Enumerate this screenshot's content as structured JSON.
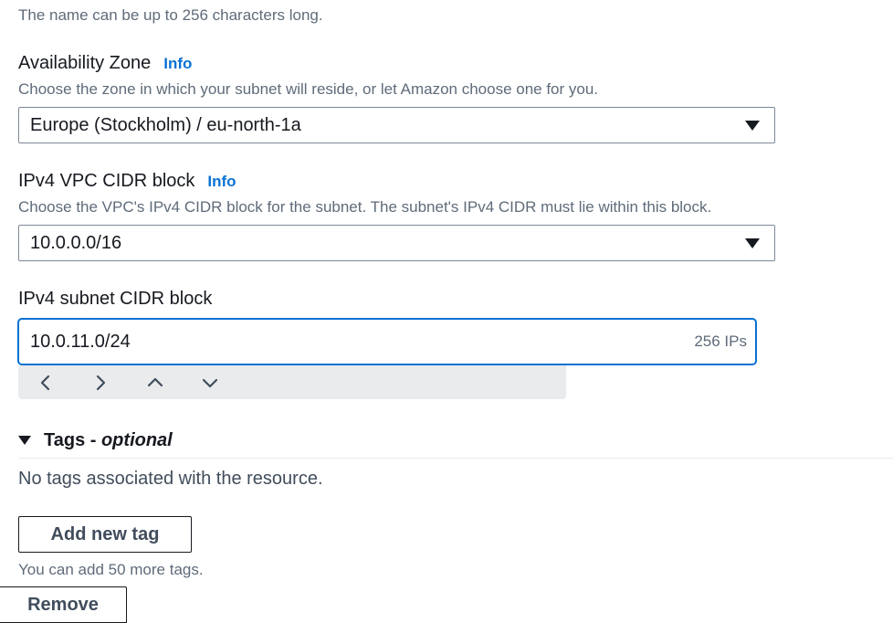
{
  "name_hint": "The name can be up to 256 characters long.",
  "availability_zone": {
    "label": "Availability Zone",
    "info": "Info",
    "description": "Choose the zone in which your subnet will reside, or let Amazon choose one for you.",
    "selected": "Europe (Stockholm) / eu-north-1a"
  },
  "vpc_cidr": {
    "label": "IPv4 VPC CIDR block",
    "info": "Info",
    "description": "Choose the VPC's IPv4 CIDR block for the subnet. The subnet's IPv4 CIDR must lie within this block.",
    "selected": "10.0.0.0/16"
  },
  "subnet_cidr": {
    "label": "IPv4 subnet CIDR block",
    "value": "10.0.11.0/24",
    "ips": "256 IPs"
  },
  "stepper": {
    "icons": [
      "chevron-left-icon",
      "chevron-right-icon",
      "chevron-up-icon",
      "chevron-down-icon"
    ]
  },
  "tags": {
    "title": "Tags - ",
    "optional": "optional",
    "empty_message": "No tags associated with the resource.",
    "add_button": "Add new tag",
    "remaining_hint": "You can add 50 more tags.",
    "remove_button": "Remove"
  },
  "colors": {
    "accent": "#0972d3",
    "text": "#16191f",
    "muted": "#5f6b7a",
    "border": "#7d8998"
  }
}
